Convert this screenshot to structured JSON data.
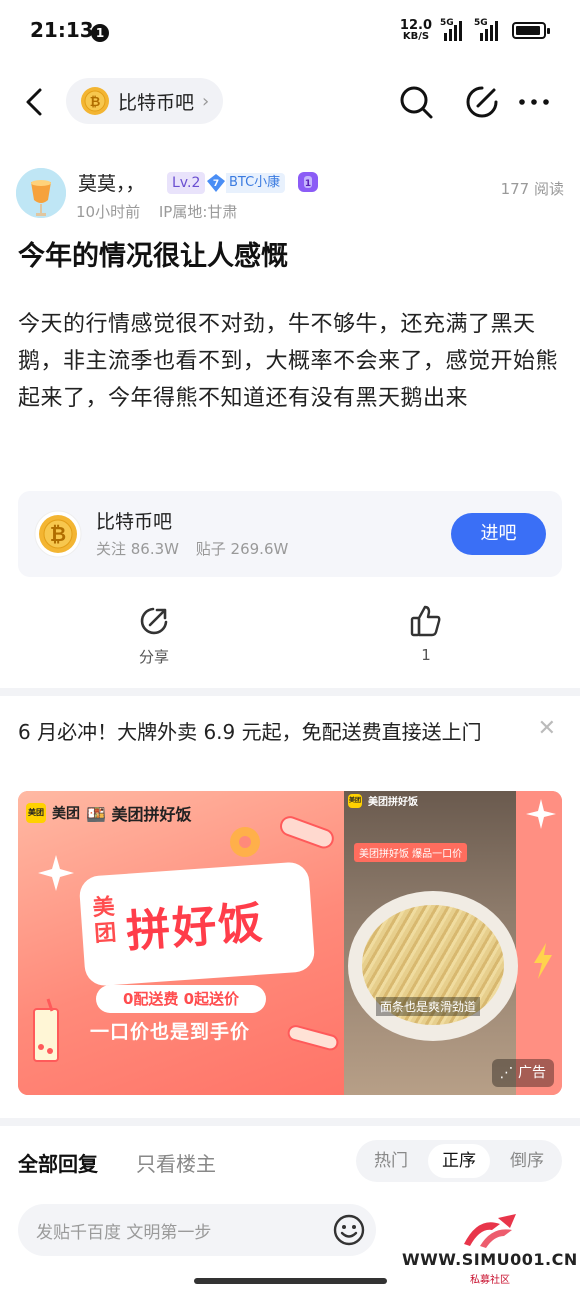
{
  "status_bar": {
    "time": "21:13",
    "notification_count": "1",
    "net_speed_value": "12.0",
    "net_speed_unit": "KB/S",
    "signal1_label": "5G",
    "signal2_label": "5G"
  },
  "nav": {
    "forum_name": "比特币吧"
  },
  "post": {
    "author_name": "莫莫，，",
    "level_badge": "Lv.2",
    "fan_badge_level": "7",
    "fan_badge_name": "BTC小康",
    "time_ago": "10小时前",
    "ip_location": "IP属地:甘肃",
    "views": "177 阅读",
    "title": "今年的情况很让人感慨",
    "body": "今天的行情感觉很不对劲，牛不够牛，还充满了黑天鹅，非主流季也看不到，大概率不会来了，感觉开始熊起来了，今年得熊不知道还有没有黑天鹅出来"
  },
  "forum_card": {
    "name": "比特币吧",
    "followers": "关注 86.3W",
    "posts": "贴子 269.6W",
    "join_label": "进吧"
  },
  "actions": {
    "share_label": "分享",
    "like_count": "1"
  },
  "ad": {
    "text": "6 月必冲！大牌外卖 6.9 元起，免配送费直接送上门",
    "brand1": "美团",
    "brand2": "美团拼好饭",
    "brand_small": "美团",
    "headline_prefix": "美团",
    "headline": "拼好饭",
    "promo_pill": "0配送费 0起送价",
    "slogan": "一口价也是到手价",
    "photo_top": "美团拼好饭 爆品一口价",
    "photo_caption": "面条也是爽滑劲道",
    "ad_label": "广告"
  },
  "replies": {
    "tab_all": "全部回复",
    "tab_op": "只看楼主",
    "sort_hot": "热门",
    "sort_asc": "正序",
    "sort_desc": "倒序"
  },
  "comment": {
    "placeholder": "发贴千百度 文明第一步"
  },
  "watermark": {
    "url": "WWW.SIMU001.CN",
    "sub": "私募社区"
  },
  "colors": {
    "accent_blue": "#3a6ff6",
    "ad_red": "#ff3d4a"
  }
}
